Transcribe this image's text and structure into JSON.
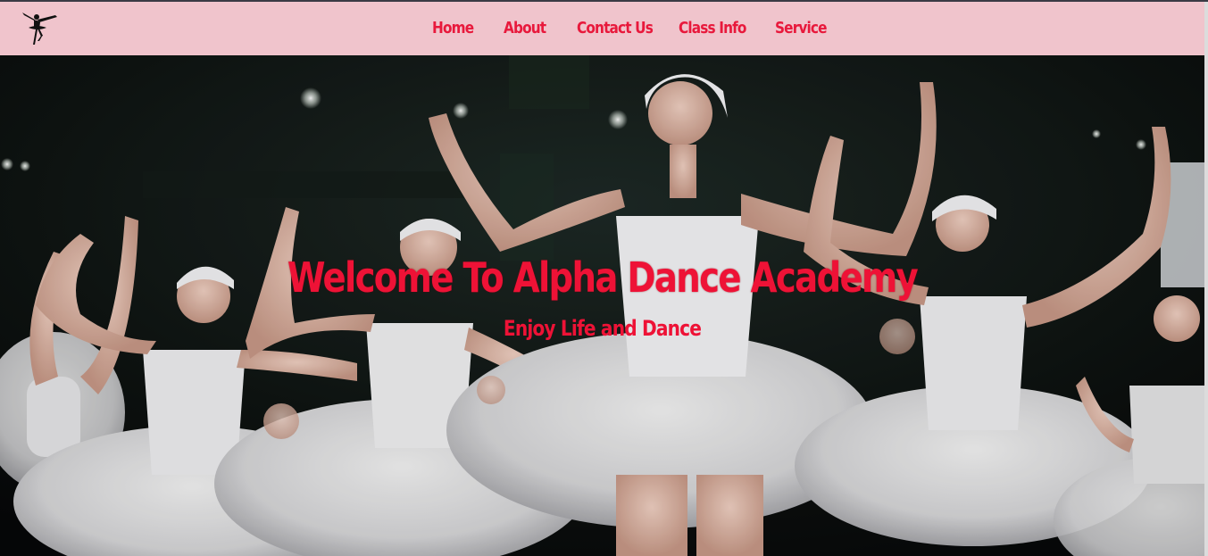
{
  "navbar": {
    "background_color": "#f0c4cc",
    "link_color": "#e8193c",
    "logo_icon": "ballerina-silhouette-icon",
    "links": [
      {
        "label": "Home"
      },
      {
        "label": "About"
      },
      {
        "label": "Contact Us"
      },
      {
        "label": "Class Info"
      },
      {
        "label": "Service"
      }
    ]
  },
  "hero": {
    "background": "ballet-dancers-photo",
    "title": "Welcome To Alpha Dance Academy",
    "subtitle": "Enjoy Life and Dance",
    "text_color": "#ee1236"
  }
}
